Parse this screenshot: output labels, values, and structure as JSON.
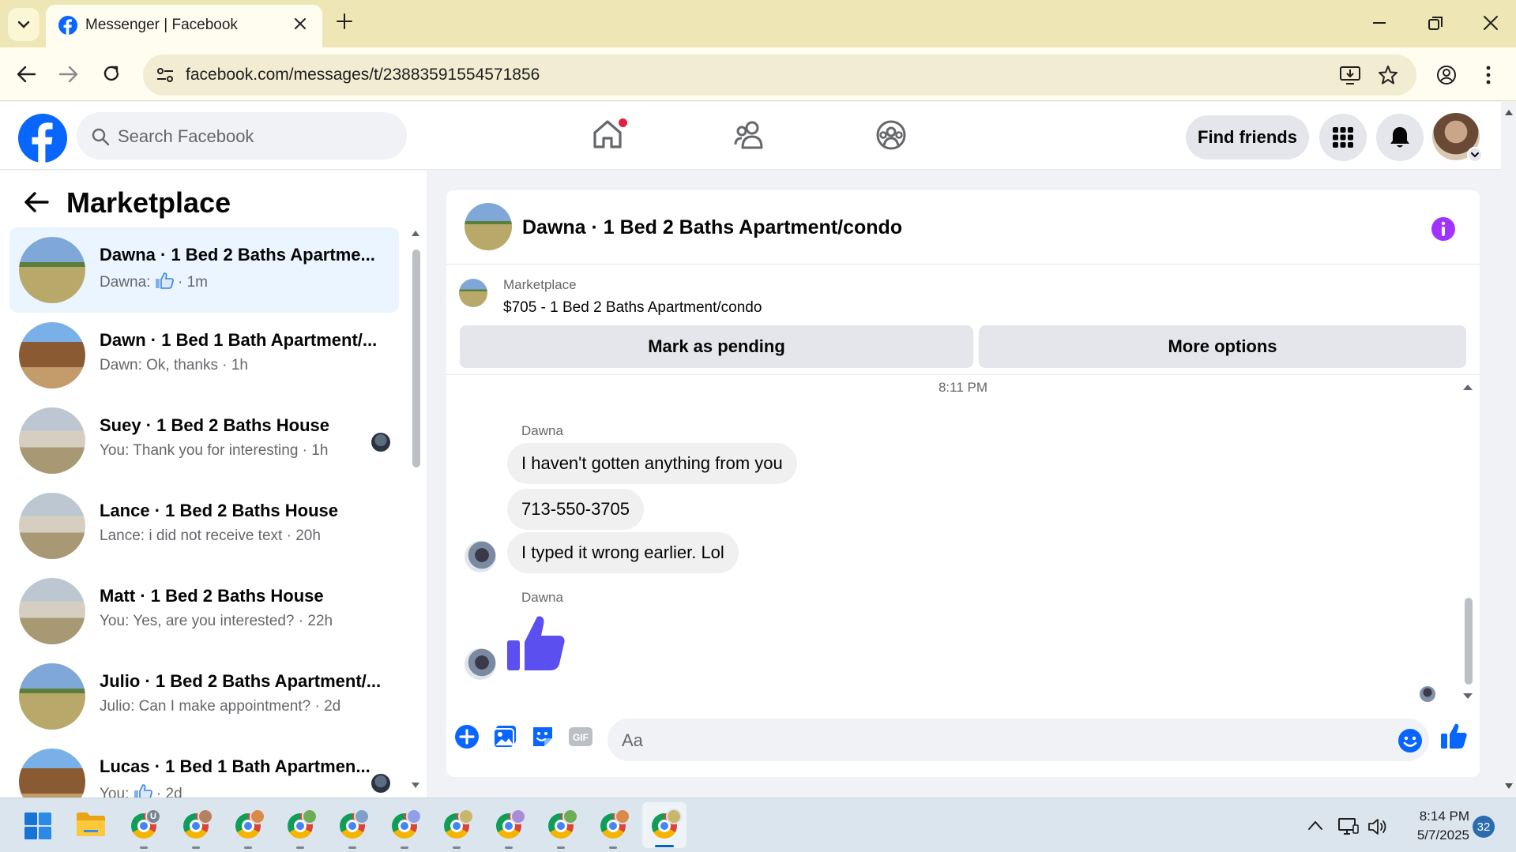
{
  "browser": {
    "tab_title": "Messenger | Facebook",
    "url": "facebook.com/messages/t/23883591554571856"
  },
  "fb_header": {
    "search_placeholder": "Search Facebook",
    "find_friends_label": "Find friends",
    "home_has_notification": true
  },
  "left_panel": {
    "title": "Marketplace",
    "conversations": [
      {
        "name": "Dawna · 1 Bed 2 Baths Apartme...",
        "preview_before_icon": "Dawna: ",
        "preview_icon": "thumbs-up-icon",
        "preview": "Dawna: · 1m",
        "time": "· 1m",
        "active": true,
        "thumb": "land"
      },
      {
        "name": "Dawn · 1 Bed 1 Bath Apartment/...",
        "preview": "Dawn: Ok, thanks · 1h",
        "thumb": "cabin"
      },
      {
        "name": "Suey · 1 Bed 2 Baths House",
        "preview": "You: Thank you for interesting · 1h",
        "thumb": "house",
        "seen": true
      },
      {
        "name": "Lance · 1 Bed 2 Baths House",
        "preview": "Lance: i did not receive text · 20h",
        "thumb": "house"
      },
      {
        "name": "Matt · 1 Bed 2 Baths House",
        "preview": "You: Yes, are you interested? · 22h",
        "thumb": "house"
      },
      {
        "name": "Julio · 1 Bed 2 Baths Apartment/...",
        "preview": "Julio: Can I make appointment? · 2d",
        "thumb": "land"
      },
      {
        "name": "Lucas · 1 Bed 1 Bath Apartmen...",
        "preview_before_icon": "You: ",
        "preview_icon": "thumbs-up-icon",
        "time": "· 2d",
        "thumb": "cabin",
        "seen": true
      }
    ]
  },
  "chat": {
    "title": "Dawna · 1 Bed 2 Baths Apartment/condo",
    "marketplace_label": "Marketplace",
    "listing": "$705 - 1 Bed 2 Baths Apartment/condo",
    "mark_pending_label": "Mark as pending",
    "more_options_label": "More options",
    "timestamp": "8:11 PM",
    "sender_1": "Dawna",
    "messages": [
      "I haven't gotten anything from you",
      "713-550-3705",
      "I typed it wrong earlier. Lol"
    ],
    "sender_2": "Dawna",
    "composer_placeholder": "Aa",
    "accent_color": "#a033ff",
    "like_color": "#5b4ff0"
  },
  "taskbar": {
    "time": "8:14 PM",
    "date": "5/7/2025",
    "notification_count": "32",
    "first_profile_badge": "U",
    "chrome_profile_badge_colors": [
      "#7a8591",
      "#b5815f",
      "#d98a4a",
      "#6cae55",
      "#7fa0c8",
      "#8fa0e8",
      "#c9b66a",
      "#a98cd8",
      "#6cae55",
      "#d98a4a",
      "#c9b66a"
    ]
  }
}
